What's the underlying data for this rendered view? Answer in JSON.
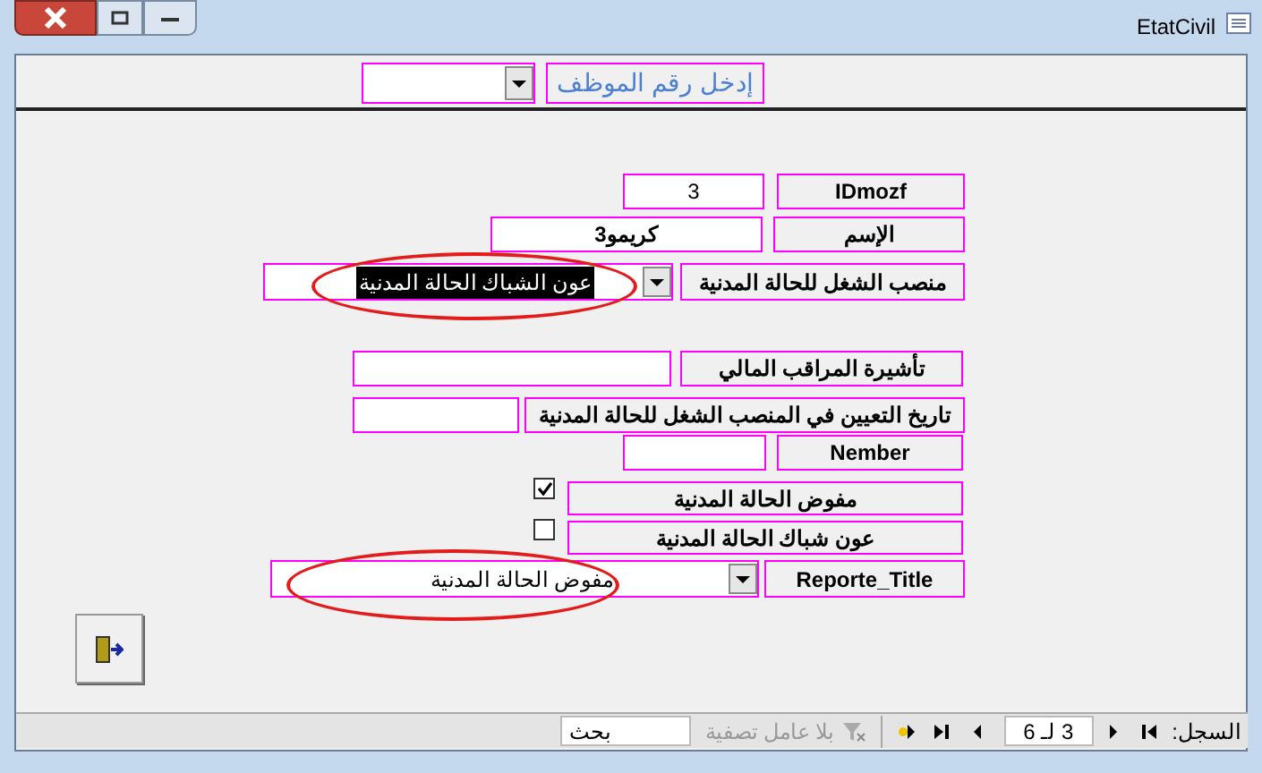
{
  "window": {
    "title": "EtatCivil"
  },
  "header": {
    "label": "إدخل رقم الموظف"
  },
  "fields": [
    {
      "kind": "text",
      "label": "IDmozf",
      "value": "3",
      "bold": false
    },
    {
      "kind": "text",
      "label": "الإسم",
      "value": "كريمو3",
      "bold": true
    },
    {
      "kind": "combo",
      "label": "منصب الشغل للحالة المدنية",
      "value": "عون الشباك الحالة المدنية",
      "highlighted": true,
      "circled": true
    },
    {
      "kind": "text",
      "label": "تأشيرة المراقب المالي"
    },
    {
      "kind": "text",
      "label": "تاريخ التعيين في  المنصب الشغل للحالة المدنية"
    },
    {
      "kind": "text",
      "label": "Nember"
    },
    {
      "kind": "checkbox",
      "label": "مفوض الحالة المدنية",
      "checked": true
    },
    {
      "kind": "checkbox",
      "label": "عون شباك الحالة المدنية",
      "checked": false
    },
    {
      "kind": "combo",
      "label": "Reporte_Title",
      "value": "مفوض الحالة المدنية",
      "highlighted": false,
      "circled": true
    }
  ],
  "status_bar": {
    "record_label": "السجل:",
    "record_value": "3 لـ 6",
    "filter": "بلا عامل تصفية",
    "search": "بحث"
  }
}
